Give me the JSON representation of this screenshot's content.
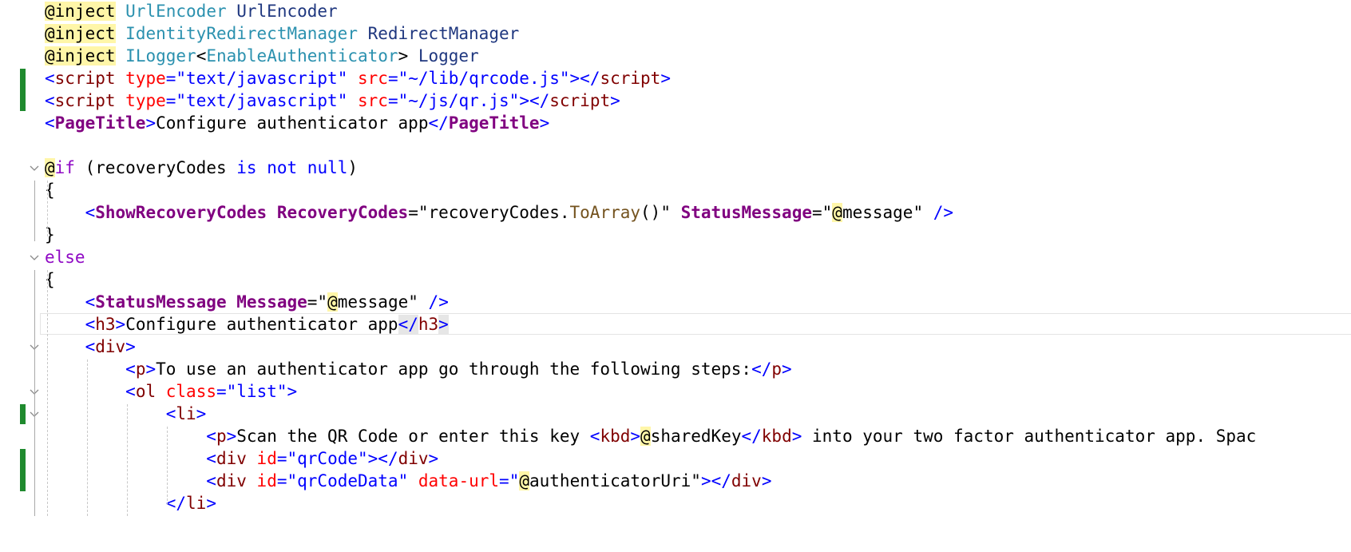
{
  "editor": {
    "language": "razor",
    "colors": {
      "gutter_change": "#1f8a2e",
      "directive_highlight": "#fff6a8",
      "html_bracket": "#0000ff",
      "html_tag": "#800000",
      "html_attr": "#ff0000",
      "component": "#800080",
      "type": "#2b91af",
      "keyword": "#0000ff",
      "control_keyword": "#8f08c4"
    },
    "lines": [
      {
        "tokens": [
          {
            "t": "@inject",
            "c": "dir"
          },
          {
            "t": " "
          },
          {
            "t": "UrlEncoder",
            "c": "tk-type"
          },
          {
            "t": " UrlEncoder",
            "c": "tk-id"
          }
        ]
      },
      {
        "tokens": [
          {
            "t": "@inject",
            "c": "dir"
          },
          {
            "t": " "
          },
          {
            "t": "IdentityRedirectManager",
            "c": "tk-type"
          },
          {
            "t": " RedirectManager",
            "c": "tk-id"
          }
        ]
      },
      {
        "tokens": [
          {
            "t": "@inject",
            "c": "dir"
          },
          {
            "t": " "
          },
          {
            "t": "ILogger",
            "c": "tk-type"
          },
          {
            "t": "<"
          },
          {
            "t": "EnableAuthenticator",
            "c": "tk-type"
          },
          {
            "t": ">"
          },
          {
            "t": " Logger",
            "c": "tk-id"
          }
        ]
      },
      {
        "tokens": [
          {
            "t": "<",
            "c": "tk-brk"
          },
          {
            "t": "script",
            "c": "tk-tag"
          },
          {
            "t": " "
          },
          {
            "t": "type",
            "c": "tk-attr"
          },
          {
            "t": "=",
            "c": "tk-brk"
          },
          {
            "t": "\"text/javascript\"",
            "c": "tk-str"
          },
          {
            "t": " "
          },
          {
            "t": "src",
            "c": "tk-attr"
          },
          {
            "t": "=",
            "c": "tk-brk"
          },
          {
            "t": "\"~/lib/qrcode.js\"",
            "c": "tk-str"
          },
          {
            "t": "></",
            "c": "tk-brk"
          },
          {
            "t": "script",
            "c": "tk-tag"
          },
          {
            "t": ">",
            "c": "tk-brk"
          }
        ]
      },
      {
        "tokens": [
          {
            "t": "<",
            "c": "tk-brk"
          },
          {
            "t": "script",
            "c": "tk-tag"
          },
          {
            "t": " "
          },
          {
            "t": "type",
            "c": "tk-attr"
          },
          {
            "t": "=",
            "c": "tk-brk"
          },
          {
            "t": "\"text/javascript\"",
            "c": "tk-str"
          },
          {
            "t": " "
          },
          {
            "t": "src",
            "c": "tk-attr"
          },
          {
            "t": "=",
            "c": "tk-brk"
          },
          {
            "t": "\"~/js/qr.js\"",
            "c": "tk-str"
          },
          {
            "t": "></",
            "c": "tk-brk"
          },
          {
            "t": "script",
            "c": "tk-tag"
          },
          {
            "t": ">",
            "c": "tk-brk"
          }
        ]
      },
      {
        "tokens": [
          {
            "t": "<",
            "c": "tk-brk"
          },
          {
            "t": "PageTitle",
            "c": "tk-comp"
          },
          {
            "t": ">",
            "c": "tk-brk"
          },
          {
            "t": "Configure authenticator app"
          },
          {
            "t": "</",
            "c": "tk-brk"
          },
          {
            "t": "PageTitle",
            "c": "tk-comp"
          },
          {
            "t": ">",
            "c": "tk-brk"
          }
        ]
      },
      {
        "tokens": []
      },
      {
        "tokens": [
          {
            "t": "@",
            "c": "dir"
          },
          {
            "t": "if",
            "c": "tk-ctrl"
          },
          {
            "t": " (recoveryCodes "
          },
          {
            "t": "is",
            "c": "tk-kw"
          },
          {
            "t": " "
          },
          {
            "t": "not",
            "c": "tk-kw"
          },
          {
            "t": " "
          },
          {
            "t": "null",
            "c": "tk-kw"
          },
          {
            "t": ")"
          }
        ]
      },
      {
        "tokens": [
          {
            "t": "{"
          }
        ]
      },
      {
        "tokens": [
          {
            "t": "    "
          },
          {
            "t": "<",
            "c": "tk-brk"
          },
          {
            "t": "ShowRecoveryCodes",
            "c": "tk-comp"
          },
          {
            "t": " "
          },
          {
            "t": "RecoveryCodes",
            "c": "tk-comp"
          },
          {
            "t": "=\""
          },
          {
            "t": "recoveryCodes."
          },
          {
            "t": "ToArray",
            "c": "tk-method"
          },
          {
            "t": "()\""
          },
          {
            "t": " "
          },
          {
            "t": "StatusMessage",
            "c": "tk-comp"
          },
          {
            "t": "=\""
          },
          {
            "t": "@",
            "c": "dir"
          },
          {
            "t": "message\""
          },
          {
            "t": " "
          },
          {
            "t": "/>",
            "c": "tk-brk"
          }
        ]
      },
      {
        "tokens": [
          {
            "t": "}"
          }
        ]
      },
      {
        "tokens": [
          {
            "t": "else",
            "c": "tk-ctrl"
          }
        ]
      },
      {
        "tokens": [
          {
            "t": "{"
          }
        ]
      },
      {
        "tokens": [
          {
            "t": "    "
          },
          {
            "t": "<",
            "c": "tk-brk"
          },
          {
            "t": "StatusMessage",
            "c": "tk-comp"
          },
          {
            "t": " "
          },
          {
            "t": "Message",
            "c": "tk-comp"
          },
          {
            "t": "=\""
          },
          {
            "t": "@",
            "c": "dir"
          },
          {
            "t": "message\""
          },
          {
            "t": " "
          },
          {
            "t": "/>",
            "c": "tk-brk"
          }
        ]
      },
      {
        "tokens": [
          {
            "t": "    "
          },
          {
            "t": "<",
            "c": "tk-brk"
          },
          {
            "t": "h3",
            "c": "tk-tag"
          },
          {
            "t": ">",
            "c": "tk-brk"
          },
          {
            "t": "Configure authenticator app"
          },
          {
            "t": "</",
            "c": "tk-hl tk-brk"
          },
          {
            "t": "h3",
            "c": "tk-tag"
          },
          {
            "t": ">",
            "c": "tk-hl tk-brk"
          }
        ]
      },
      {
        "tokens": [
          {
            "t": "    "
          },
          {
            "t": "<",
            "c": "tk-brk"
          },
          {
            "t": "div",
            "c": "tk-tag"
          },
          {
            "t": ">",
            "c": "tk-brk"
          }
        ]
      },
      {
        "tokens": [
          {
            "t": "        "
          },
          {
            "t": "<",
            "c": "tk-brk"
          },
          {
            "t": "p",
            "c": "tk-tag"
          },
          {
            "t": ">",
            "c": "tk-brk"
          },
          {
            "t": "To use an authenticator app go through the following steps:"
          },
          {
            "t": "</",
            "c": "tk-brk"
          },
          {
            "t": "p",
            "c": "tk-tag"
          },
          {
            "t": ">",
            "c": "tk-brk"
          }
        ]
      },
      {
        "tokens": [
          {
            "t": "        "
          },
          {
            "t": "<",
            "c": "tk-brk"
          },
          {
            "t": "ol",
            "c": "tk-tag"
          },
          {
            "t": " "
          },
          {
            "t": "class",
            "c": "tk-attr"
          },
          {
            "t": "=",
            "c": "tk-brk"
          },
          {
            "t": "\"list\"",
            "c": "tk-str"
          },
          {
            "t": ">",
            "c": "tk-brk"
          }
        ]
      },
      {
        "tokens": [
          {
            "t": "            "
          },
          {
            "t": "<",
            "c": "tk-brk"
          },
          {
            "t": "li",
            "c": "tk-tag"
          },
          {
            "t": ">",
            "c": "tk-brk"
          }
        ]
      },
      {
        "tokens": [
          {
            "t": "                "
          },
          {
            "t": "<",
            "c": "tk-brk"
          },
          {
            "t": "p",
            "c": "tk-tag"
          },
          {
            "t": ">",
            "c": "tk-brk"
          },
          {
            "t": "Scan the QR Code or enter this key "
          },
          {
            "t": "<",
            "c": "tk-brk"
          },
          {
            "t": "kbd",
            "c": "tk-tag"
          },
          {
            "t": ">",
            "c": "tk-brk"
          },
          {
            "t": "@",
            "c": "dir"
          },
          {
            "t": "sharedKey"
          },
          {
            "t": "</",
            "c": "tk-brk"
          },
          {
            "t": "kbd",
            "c": "tk-tag"
          },
          {
            "t": ">",
            "c": "tk-brk"
          },
          {
            "t": " into your two factor authenticator app. Spac"
          }
        ]
      },
      {
        "tokens": [
          {
            "t": "                "
          },
          {
            "t": "<",
            "c": "tk-brk"
          },
          {
            "t": "div",
            "c": "tk-tag"
          },
          {
            "t": " "
          },
          {
            "t": "id",
            "c": "tk-attr"
          },
          {
            "t": "=",
            "c": "tk-brk"
          },
          {
            "t": "\"qrCode\"",
            "c": "tk-str"
          },
          {
            "t": "></",
            "c": "tk-brk"
          },
          {
            "t": "div",
            "c": "tk-tag"
          },
          {
            "t": ">",
            "c": "tk-brk"
          }
        ]
      },
      {
        "tokens": [
          {
            "t": "                "
          },
          {
            "t": "<",
            "c": "tk-brk"
          },
          {
            "t": "div",
            "c": "tk-tag"
          },
          {
            "t": " "
          },
          {
            "t": "id",
            "c": "tk-attr"
          },
          {
            "t": "=",
            "c": "tk-brk"
          },
          {
            "t": "\"qrCodeData\"",
            "c": "tk-str"
          },
          {
            "t": " "
          },
          {
            "t": "data-url",
            "c": "tk-attr"
          },
          {
            "t": "=",
            "c": "tk-brk"
          },
          {
            "t": "\"",
            "c": "tk-str"
          },
          {
            "t": "@",
            "c": "dir"
          },
          {
            "t": "authenticatorUri\"",
            "c": "tk-txt"
          },
          {
            "t": "></",
            "c": "tk-brk"
          },
          {
            "t": "div",
            "c": "tk-tag"
          },
          {
            "t": ">",
            "c": "tk-brk"
          }
        ]
      },
      {
        "tokens": [
          {
            "t": "            "
          },
          {
            "t": "</",
            "c": "tk-brk"
          },
          {
            "t": "li",
            "c": "tk-tag"
          },
          {
            "t": ">",
            "c": "tk-brk"
          }
        ]
      }
    ]
  }
}
